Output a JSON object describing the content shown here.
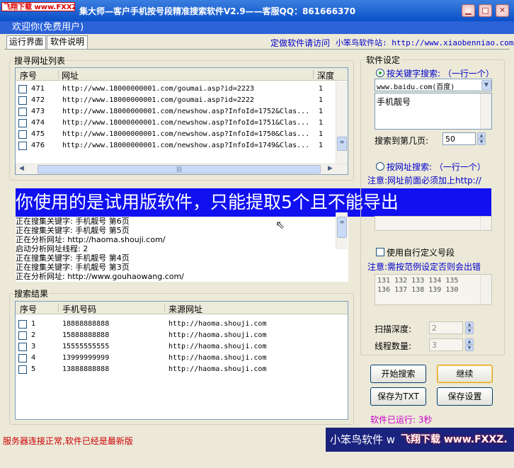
{
  "window": {
    "logo_text": "飞翔下载 www.FXXZ.com",
    "title": "集大师—客户手机按号段精准搜索软件V2.9——客服QQ：861666370"
  },
  "welcome": "欢迎你(免费用户)",
  "tabs": [
    "运行界面",
    "软件说明"
  ],
  "top_links": {
    "custom": "定做软件请访问",
    "site": "小笨鸟软件站: http://www.xiaobenniao.com/"
  },
  "url_list": {
    "title": "搜寻网址列表",
    "headers": [
      "序号",
      "网址",
      "深度"
    ],
    "rows": [
      {
        "id": "471",
        "url": "http://www.18000000001.com/goumai.asp?id=2223",
        "depth": "1"
      },
      {
        "id": "472",
        "url": "http://www.18000000001.com/goumai.asp?id=2222",
        "depth": "1"
      },
      {
        "id": "473",
        "url": "http://www.18000000001.com/newshow.asp?InfoId=1752&Clas...",
        "depth": "1"
      },
      {
        "id": "474",
        "url": "http://www.18000000001.com/newshow.asp?InfoId=1751&Clas...",
        "depth": "1"
      },
      {
        "id": "475",
        "url": "http://www.18000000001.com/newshow.asp?InfoId=1750&Clas...",
        "depth": "1"
      },
      {
        "id": "476",
        "url": "http://www.18000000001.com/newshow.asp?InfoId=1749&Clas...",
        "depth": "1"
      }
    ]
  },
  "trial_banner": "你使用的是试用版软件，只能提取5个且不能导出",
  "log_lines": [
    "正在搜集关键字: 手机靓号   第6页",
    "正在搜集关键字: 手机靓号   第5页",
    "正在分析网址: http://haoma.shouji.com/",
    "启动分析网址线程: 2",
    "正在搜集关键字: 手机靓号   第4页",
    "正在搜集关键字: 手机靓号   第3页",
    "正在分析网址: http://www.gouhaowang.com/"
  ],
  "results": {
    "title": "搜索结果",
    "headers": [
      "序号",
      "手机号码",
      "来源网址"
    ],
    "rows": [
      {
        "id": "1",
        "phone": "18888888888",
        "src": "http://haoma.shouji.com"
      },
      {
        "id": "2",
        "phone": "15888888888",
        "src": "http://haoma.shouji.com"
      },
      {
        "id": "3",
        "phone": "15555555555",
        "src": "http://haoma.shouji.com"
      },
      {
        "id": "4",
        "phone": "13999999999",
        "src": "http://haoma.shouji.com"
      },
      {
        "id": "5",
        "phone": "13888888888",
        "src": "http://haoma.shouji.com"
      }
    ]
  },
  "settings": {
    "title": "软件设定",
    "keyword_radio": "按关键字搜索: （一行一个）",
    "engine": "www.baidu.com(百度)",
    "keyword_text": "手机靓号",
    "pages_label": "搜索到第几页:",
    "pages_value": "50",
    "url_radio": "按网址搜索: （一行一个）",
    "url_note": "注意:网址前面必须加上http://",
    "custom_check": "使用自行定义号段",
    "custom_note": "注意:需按范例设定否则会出错",
    "segments": [
      "131 132 133 134 135",
      "136 137 138 139 130"
    ],
    "depth_label": "扫描深度:",
    "depth_value": "2",
    "threads_label": "线程数量:",
    "threads_value": "3"
  },
  "buttons": {
    "start": "开始搜索",
    "continue": "继续",
    "save_txt": "保存为TXT",
    "save_settings": "保存设置"
  },
  "runtime": "软件已运行: 3秒",
  "status": "服务器连接正常,软件已经是最新版",
  "footer_brand": "小笨鸟软件 w",
  "watermark": "飞翔下载 www.FXXZ.com"
}
